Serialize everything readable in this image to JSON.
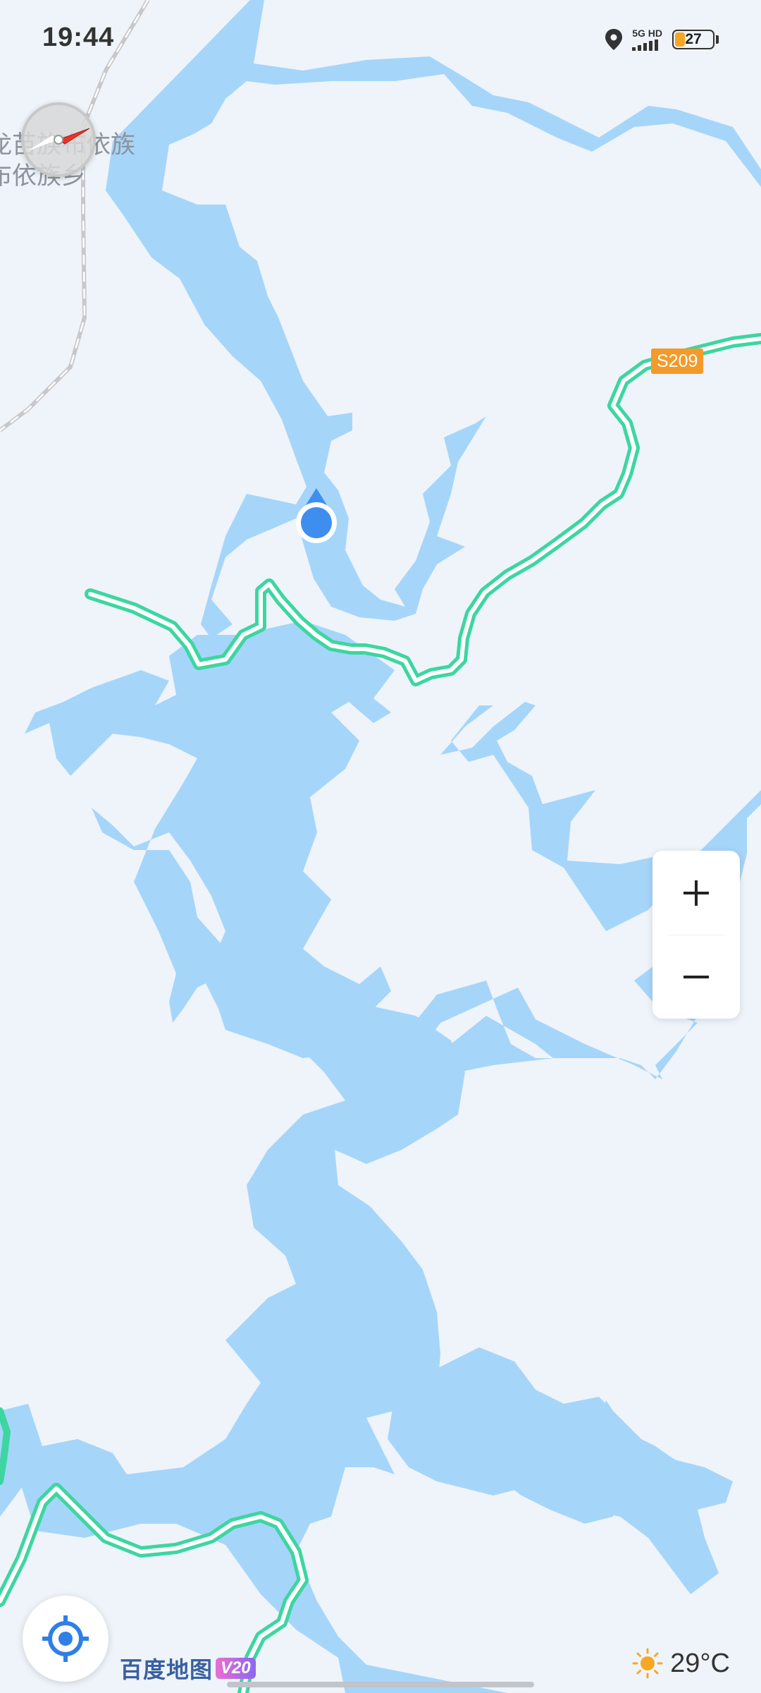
{
  "status_bar": {
    "time": "19:44",
    "network_label": "5G HD",
    "battery_level": "27",
    "battery_fraction": 0.27
  },
  "map": {
    "place_labels": [
      "龙苗族布依族",
      "布依族乡"
    ],
    "road_shield": "S209",
    "colors": {
      "land": "#eef4fa",
      "water": "#a6d5fa",
      "highway": "#3dd6a0",
      "road_shield": "#f39a2b",
      "location_dot": "#3e8ef0"
    }
  },
  "controls": {
    "zoom_in_icon": "plus-icon",
    "zoom_out_icon": "minus-icon",
    "locate_icon": "locate-icon",
    "compass_icon": "compass-icon"
  },
  "footer": {
    "brand_name": "百度地图",
    "brand_version": "V20",
    "weather_temp": "29°C",
    "weather_icon": "sun-icon"
  }
}
